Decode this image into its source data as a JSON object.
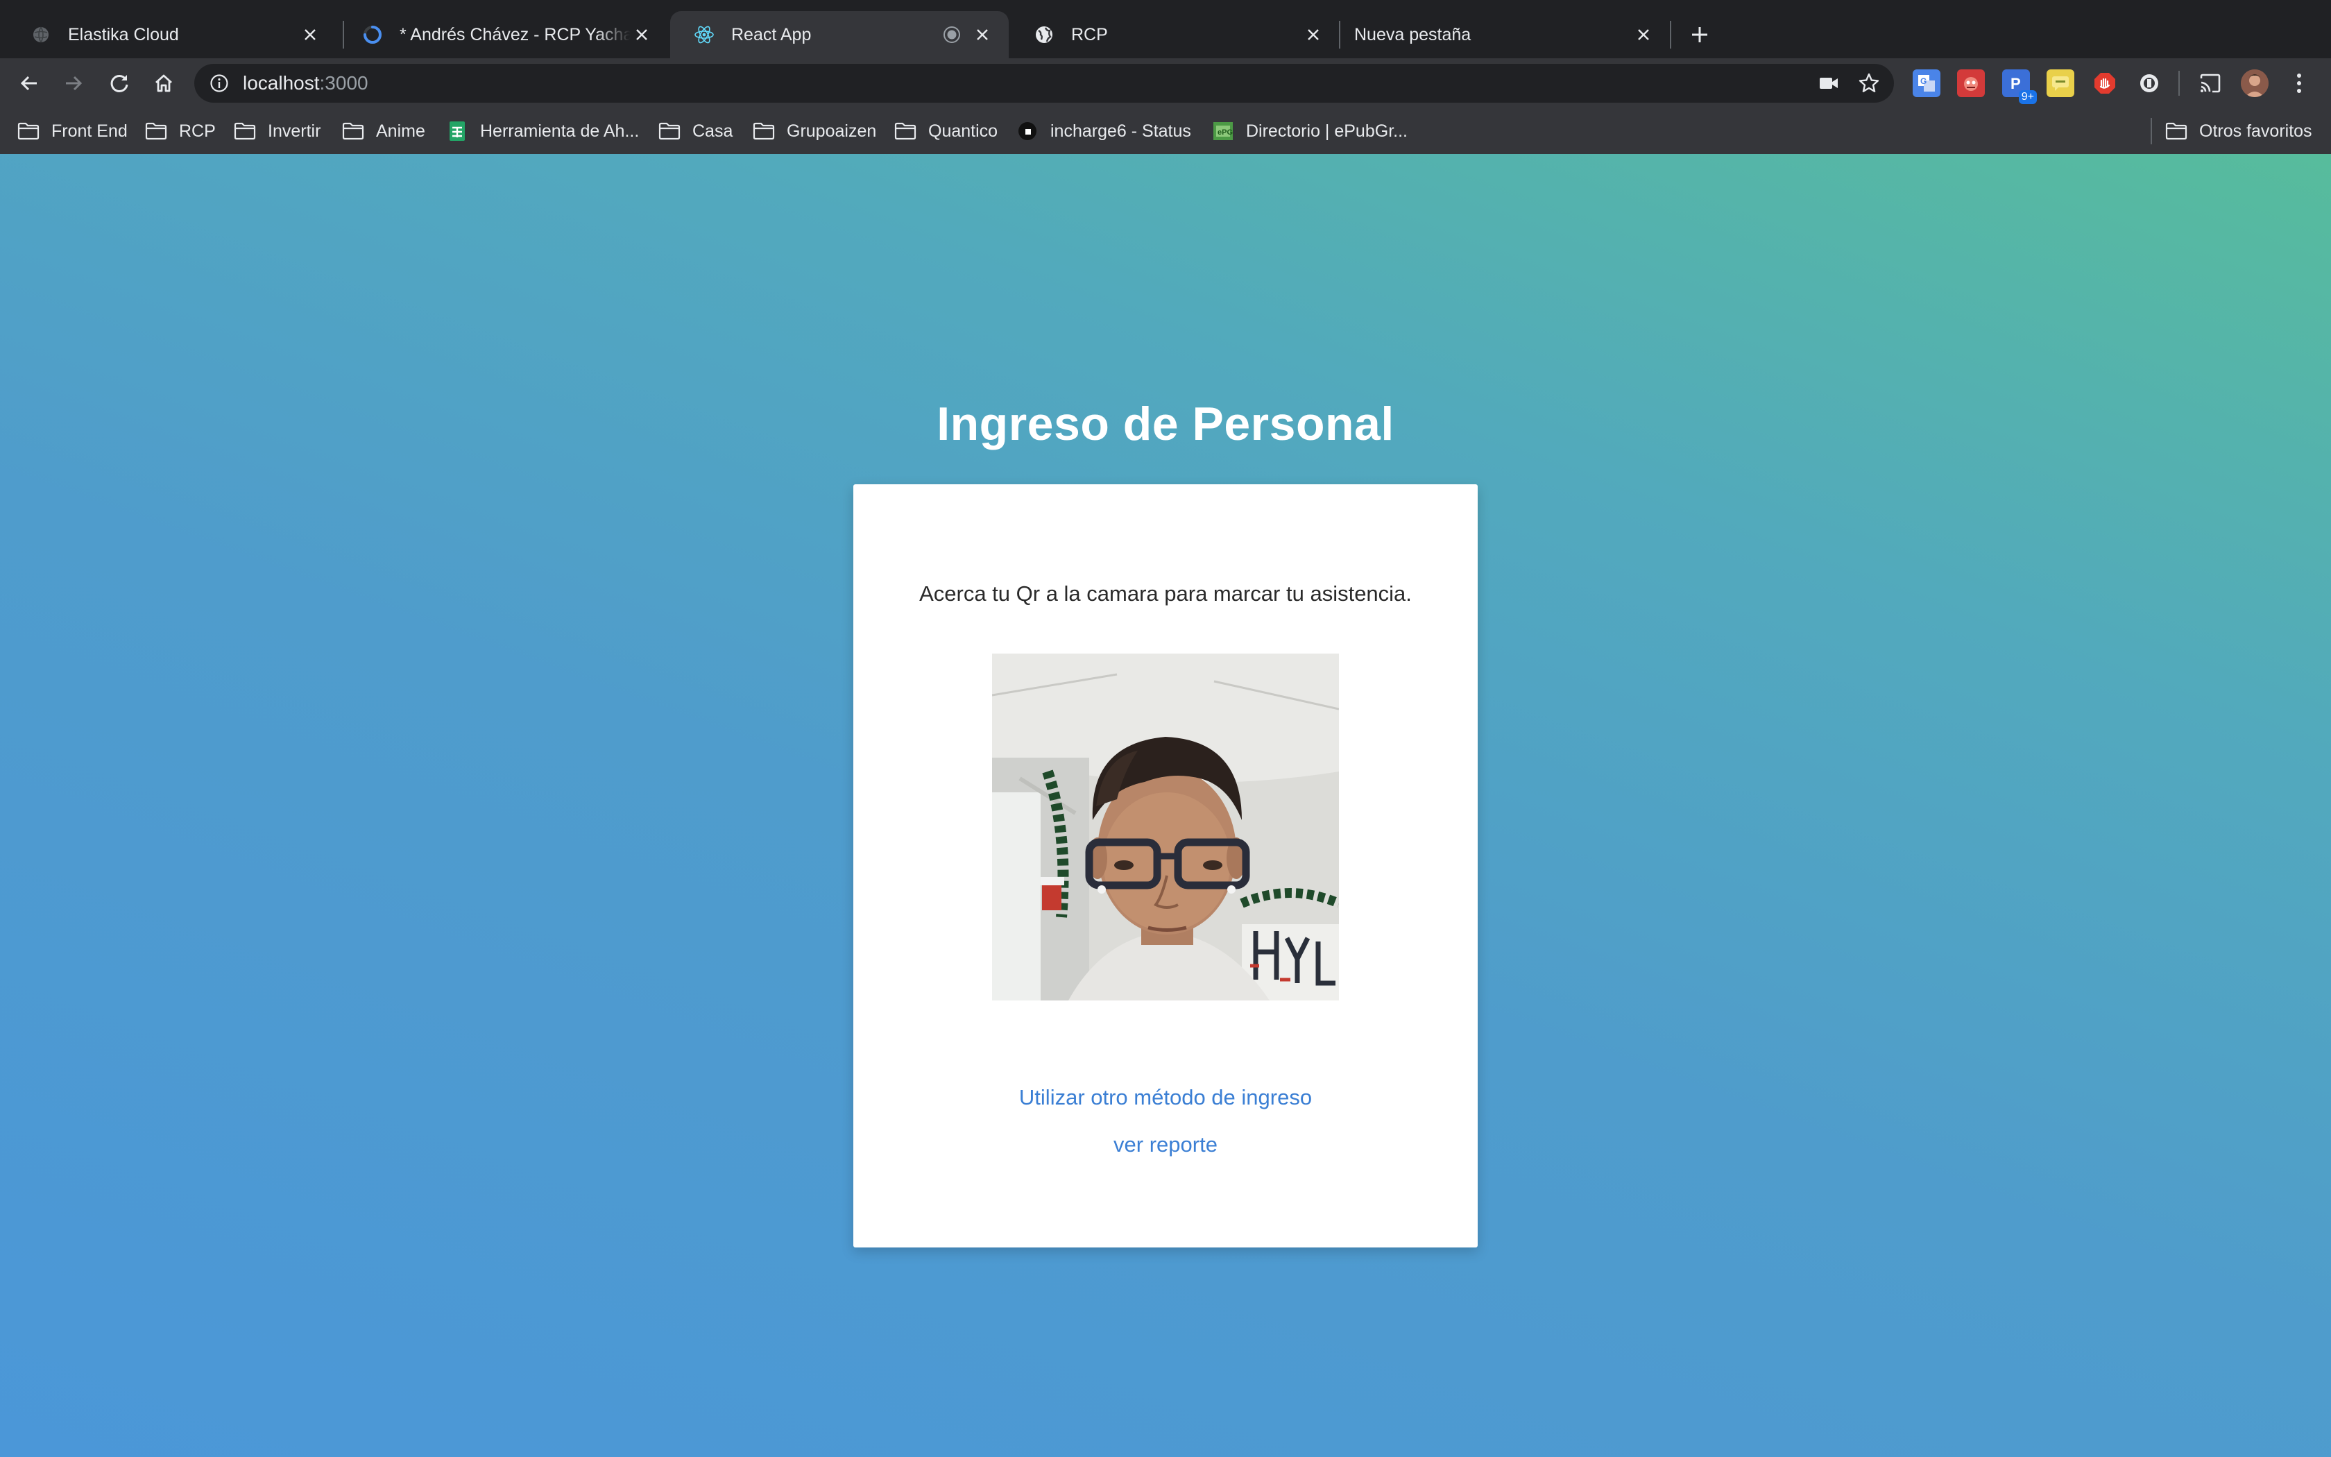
{
  "browser": {
    "tabs": [
      {
        "title": "Elastika Cloud",
        "icon": "globe-icon",
        "active": false
      },
      {
        "title": "* Andrés Chávez - RCP Yachay N",
        "icon": "loading-icon",
        "active": false
      },
      {
        "title": "React App",
        "icon": "react-logo-icon",
        "active": true
      },
      {
        "title": "RCP",
        "icon": "globe-icon",
        "active": false
      },
      {
        "title": "Nueva pestaña",
        "icon": "",
        "active": false
      }
    ],
    "new_tab_icon": "plus-icon",
    "url": {
      "host": "localhost",
      "port": ":3000"
    },
    "bookmarks": [
      {
        "label": "Front End",
        "icon": "folder-icon"
      },
      {
        "label": "RCP",
        "icon": "folder-icon"
      },
      {
        "label": "Invertir",
        "icon": "folder-icon"
      },
      {
        "label": "Anime",
        "icon": "folder-icon"
      },
      {
        "label": "Herramienta de Ah...",
        "icon": "sheets-icon"
      },
      {
        "label": "Casa",
        "icon": "folder-icon"
      },
      {
        "label": "Grupoaizen",
        "icon": "folder-icon"
      },
      {
        "label": "Quantico",
        "icon": "folder-icon"
      },
      {
        "label": "incharge6 - Status",
        "icon": "status-icon"
      },
      {
        "label": "Directorio | ePubGr...",
        "icon": "epub-icon"
      }
    ],
    "other_bookmarks": "Otros favoritos",
    "extension_badge": "9+"
  },
  "page": {
    "title": "Ingreso de Personal",
    "instruction": "Acerca tu Qr a la camara para marcar tu asistencia.",
    "link_other_method": "Utilizar otro método de ingreso",
    "link_report": "ver reporte"
  },
  "colors": {
    "gradient_top_right": "#57bc9c",
    "gradient_bottom_left": "#4b97d8",
    "link": "#3b7fd4",
    "chrome_dark": "#202124",
    "chrome_toolbar": "#35363a"
  }
}
